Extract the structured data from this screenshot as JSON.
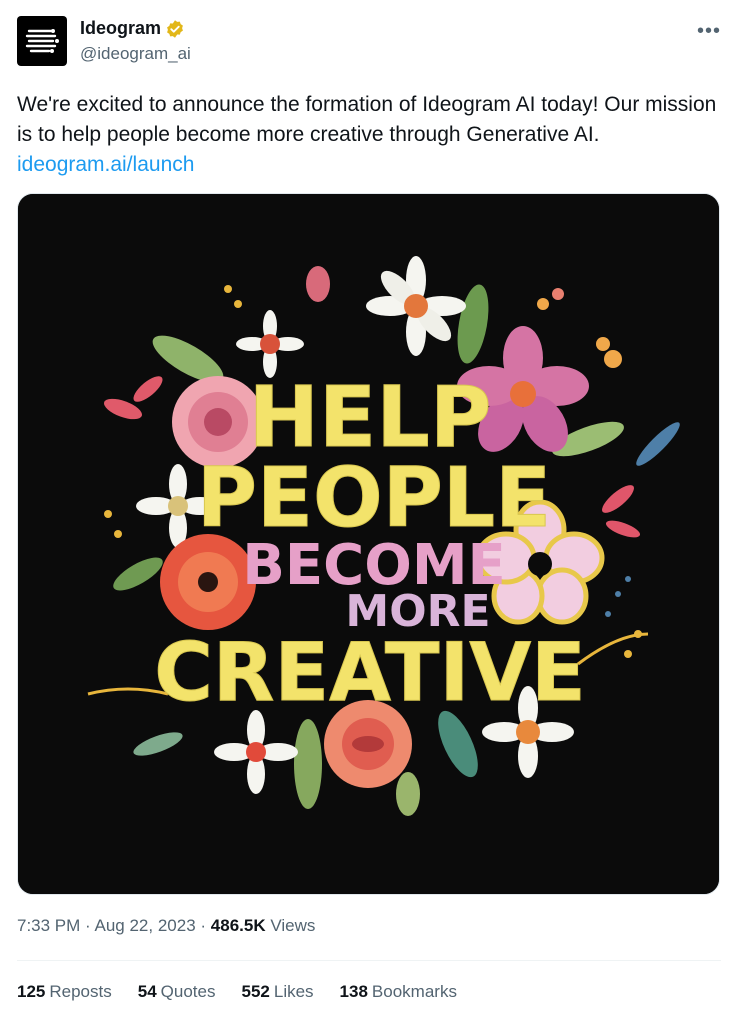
{
  "account": {
    "display_name": "Ideogram",
    "handle": "@ideogram_ai",
    "verified_badge_color": "#E2B719"
  },
  "more_icon": "more-options-icon",
  "tweet": {
    "text": "We're excited to announce the formation of Ideogram AI today! Our mission is to help people become more creative through Generative AI.",
    "link": "ideogram.ai/launch"
  },
  "image": {
    "background": "#0b0b0b",
    "words": {
      "line1": "HELP",
      "line2": "PEOPLE",
      "line3": "BECOME",
      "line4": "MORE",
      "line5": "CREATIVE"
    }
  },
  "meta": {
    "time": "7:33 PM",
    "date": "Aug 22, 2023",
    "views_count": "486.5K",
    "views_label": "Views"
  },
  "stats": {
    "reposts_count": "125",
    "reposts_label": "Reposts",
    "quotes_count": "54",
    "quotes_label": "Quotes",
    "likes_count": "552",
    "likes_label": "Likes",
    "bookmarks_count": "138",
    "bookmarks_label": "Bookmarks"
  },
  "colors": {
    "link": "#1d9bf0",
    "muted": "#536471",
    "text": "#0f1419",
    "yellow_letters": "#F3E36B"
  }
}
